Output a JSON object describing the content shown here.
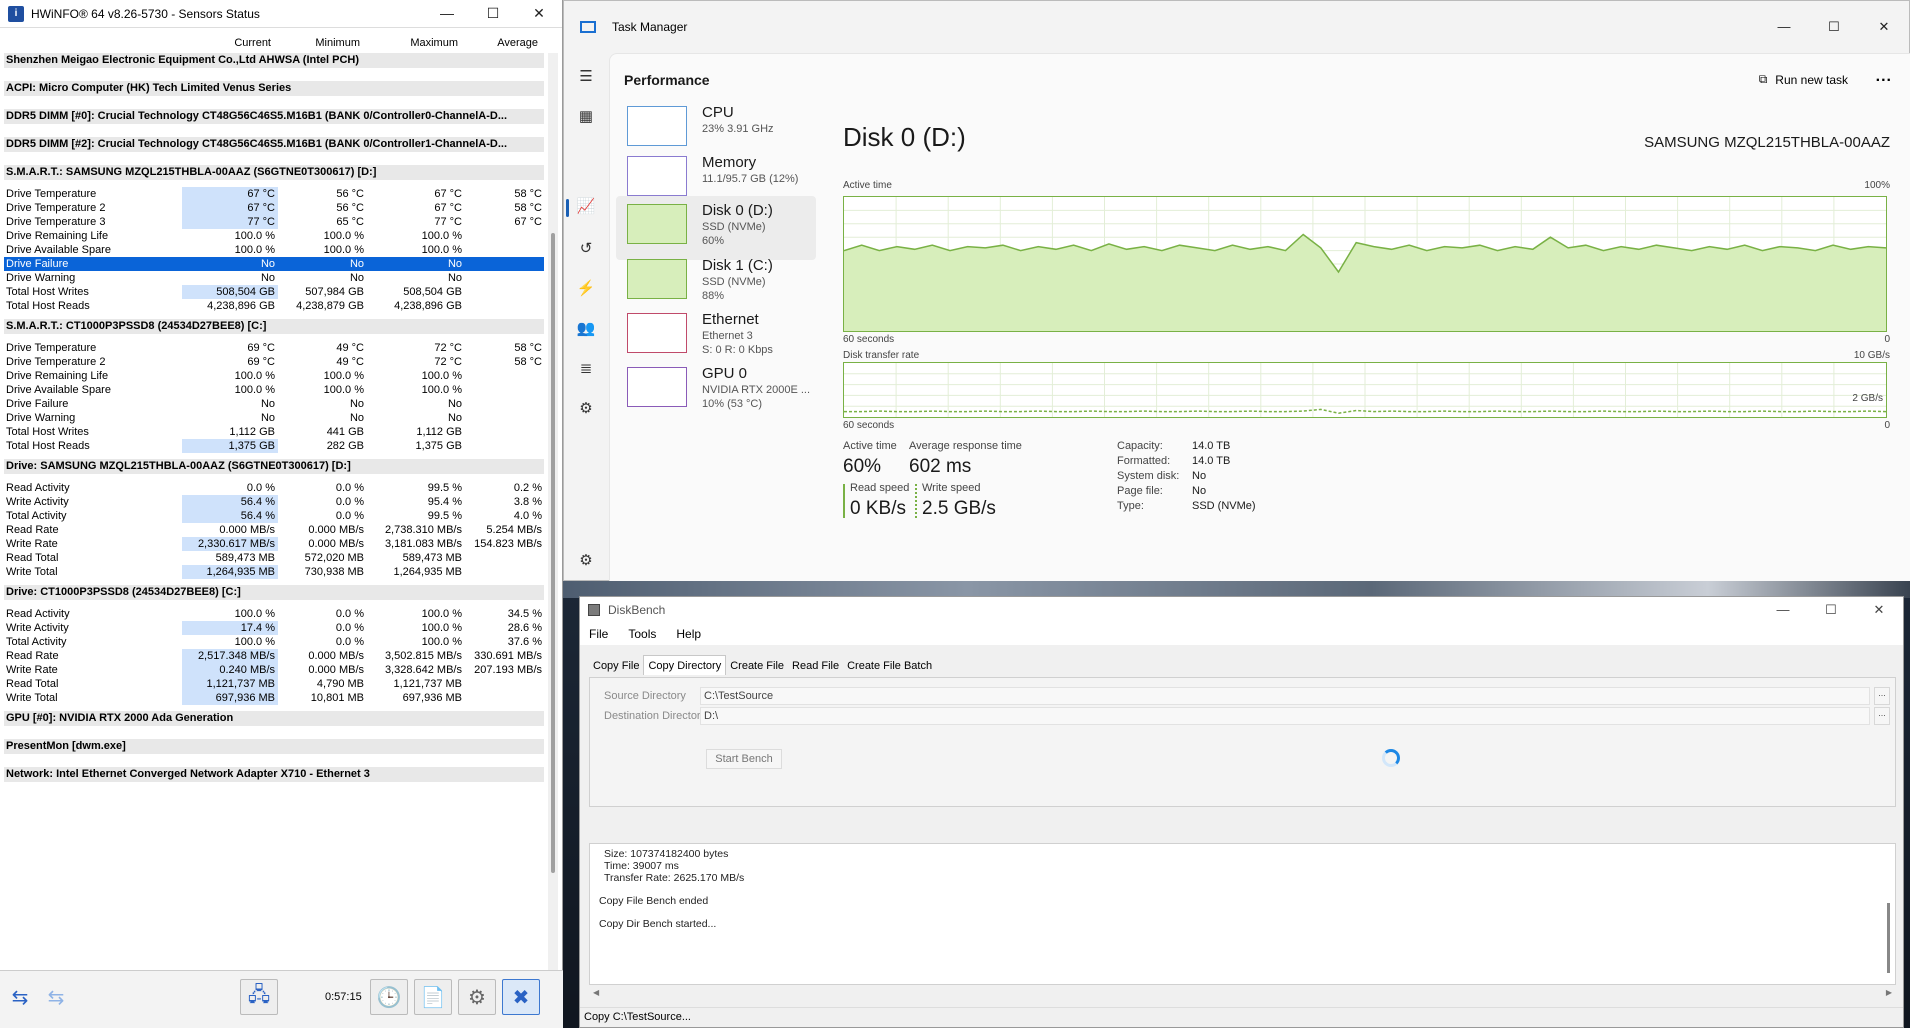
{
  "hwinfo": {
    "title": "HWiNFO® 64 v8.26-5730 - Sensors Status",
    "columns": [
      "Current",
      "Minimum",
      "Maximum",
      "Average"
    ],
    "toolbar_time": "0:57:15",
    "sections": [
      {
        "type": "header",
        "text": "Shenzhen Meigao Electronic Equipment Co.,Ltd AHWSA (Intel PCH)"
      },
      {
        "type": "header",
        "text": "ACPI: Micro Computer (HK) Tech Limited Venus Series"
      },
      {
        "type": "header",
        "text": "DDR5 DIMM [#0]: Crucial Technology CT48G56C46S5.M16B1 (BANK 0/Controller0-ChannelA-D..."
      },
      {
        "type": "header",
        "text": "DDR5 DIMM [#2]: Crucial Technology CT48G56C46S5.M16B1 (BANK 0/Controller1-ChannelA-D..."
      },
      {
        "type": "header",
        "text": "S.M.A.R.T.: SAMSUNG MZQL215THBLA-00AAZ (S6GTNE0T300617) [D:]"
      },
      {
        "type": "row",
        "label": "Drive Temperature",
        "cur": "67 °C",
        "min": "56 °C",
        "max": "67 °C",
        "avg": "58 °C",
        "hl": true
      },
      {
        "type": "row",
        "label": "Drive Temperature 2",
        "cur": "67 °C",
        "min": "56 °C",
        "max": "67 °C",
        "avg": "58 °C",
        "hl": true
      },
      {
        "type": "row",
        "label": "Drive Temperature 3",
        "cur": "77 °C",
        "min": "65 °C",
        "max": "77 °C",
        "avg": "67 °C",
        "hl": true
      },
      {
        "type": "row",
        "label": "Drive Remaining Life",
        "cur": "100.0 %",
        "min": "100.0 %",
        "max": "100.0 %",
        "avg": ""
      },
      {
        "type": "row",
        "label": "Drive Available Spare",
        "cur": "100.0 %",
        "min": "100.0 %",
        "max": "100.0 %",
        "avg": ""
      },
      {
        "type": "row",
        "label": "Drive Failure",
        "cur": "No",
        "min": "No",
        "max": "No",
        "avg": "",
        "sel": true
      },
      {
        "type": "row",
        "label": "Drive Warning",
        "cur": "No",
        "min": "No",
        "max": "No",
        "avg": ""
      },
      {
        "type": "row",
        "label": "Total Host Writes",
        "cur": "508,504 GB",
        "min": "507,984 GB",
        "max": "508,504 GB",
        "avg": "",
        "hl": true
      },
      {
        "type": "row",
        "label": "Total Host Reads",
        "cur": "4,238,896 GB",
        "min": "4,238,879 GB",
        "max": "4,238,896 GB",
        "avg": ""
      },
      {
        "type": "header",
        "text": "S.M.A.R.T.: CT1000P3PSSD8 (24534D27BEE8) [C:]"
      },
      {
        "type": "row",
        "label": "Drive Temperature",
        "cur": "69 °C",
        "min": "49 °C",
        "max": "72 °C",
        "avg": "58 °C"
      },
      {
        "type": "row",
        "label": "Drive Temperature 2",
        "cur": "69 °C",
        "min": "49 °C",
        "max": "72 °C",
        "avg": "58 °C"
      },
      {
        "type": "row",
        "label": "Drive Remaining Life",
        "cur": "100.0 %",
        "min": "100.0 %",
        "max": "100.0 %",
        "avg": ""
      },
      {
        "type": "row",
        "label": "Drive Available Spare",
        "cur": "100.0 %",
        "min": "100.0 %",
        "max": "100.0 %",
        "avg": ""
      },
      {
        "type": "row",
        "label": "Drive Failure",
        "cur": "No",
        "min": "No",
        "max": "No",
        "avg": ""
      },
      {
        "type": "row",
        "label": "Drive Warning",
        "cur": "No",
        "min": "No",
        "max": "No",
        "avg": ""
      },
      {
        "type": "row",
        "label": "Total Host Writes",
        "cur": "1,112 GB",
        "min": "441 GB",
        "max": "1,112 GB",
        "avg": ""
      },
      {
        "type": "row",
        "label": "Total Host Reads",
        "cur": "1,375 GB",
        "min": "282 GB",
        "max": "1,375 GB",
        "avg": "",
        "hl": true
      },
      {
        "type": "header",
        "text": "Drive: SAMSUNG MZQL215THBLA-00AAZ (S6GTNE0T300617) [D:]"
      },
      {
        "type": "row",
        "label": "Read Activity",
        "cur": "0.0 %",
        "min": "0.0 %",
        "max": "99.5 %",
        "avg": "0.2 %"
      },
      {
        "type": "row",
        "label": "Write Activity",
        "cur": "56.4 %",
        "min": "0.0 %",
        "max": "95.4 %",
        "avg": "3.8 %",
        "hl": true
      },
      {
        "type": "row",
        "label": "Total Activity",
        "cur": "56.4 %",
        "min": "0.0 %",
        "max": "99.5 %",
        "avg": "4.0 %",
        "hl": true
      },
      {
        "type": "row",
        "label": "Read Rate",
        "cur": "0.000 MB/s",
        "min": "0.000 MB/s",
        "max": "2,738.310 MB/s",
        "avg": "5.254 MB/s"
      },
      {
        "type": "row",
        "label": "Write Rate",
        "cur": "2,330.617 MB/s",
        "min": "0.000 MB/s",
        "max": "3,181.083 MB/s",
        "avg": "154.823 MB/s",
        "hl": true
      },
      {
        "type": "row",
        "label": "Read Total",
        "cur": "589,473 MB",
        "min": "572,020 MB",
        "max": "589,473 MB",
        "avg": ""
      },
      {
        "type": "row",
        "label": "Write Total",
        "cur": "1,264,935 MB",
        "min": "730,938 MB",
        "max": "1,264,935 MB",
        "avg": "",
        "hl": true
      },
      {
        "type": "header",
        "text": "Drive: CT1000P3PSSD8 (24534D27BEE8) [C:]"
      },
      {
        "type": "row",
        "label": "Read Activity",
        "cur": "100.0 %",
        "min": "0.0 %",
        "max": "100.0 %",
        "avg": "34.5 %"
      },
      {
        "type": "row",
        "label": "Write Activity",
        "cur": "17.4 %",
        "min": "0.0 %",
        "max": "100.0 %",
        "avg": "28.6 %",
        "hl": true
      },
      {
        "type": "row",
        "label": "Total Activity",
        "cur": "100.0 %",
        "min": "0.0 %",
        "max": "100.0 %",
        "avg": "37.6 %"
      },
      {
        "type": "row",
        "label": "Read Rate",
        "cur": "2,517.348 MB/s",
        "min": "0.000 MB/s",
        "max": "3,502.815 MB/s",
        "avg": "330.691 MB/s",
        "hl": true
      },
      {
        "type": "row",
        "label": "Write Rate",
        "cur": "0.240 MB/s",
        "min": "0.000 MB/s",
        "max": "3,328.642 MB/s",
        "avg": "207.193 MB/s",
        "hl": true
      },
      {
        "type": "row",
        "label": "Read Total",
        "cur": "1,121,737 MB",
        "min": "4,790 MB",
        "max": "1,121,737 MB",
        "avg": "",
        "hl": true
      },
      {
        "type": "row",
        "label": "Write Total",
        "cur": "697,936 MB",
        "min": "10,801 MB",
        "max": "697,936 MB",
        "avg": "",
        "hl": true
      },
      {
        "type": "header",
        "text": "GPU [#0]: NVIDIA RTX 2000 Ada Generation"
      },
      {
        "type": "header",
        "text": "PresentMon [dwm.exe]"
      },
      {
        "type": "header",
        "text": "Network: Intel Ethernet Converged Network Adapter X710 - Ethernet 3"
      }
    ]
  },
  "taskmanager": {
    "title": "Task Manager",
    "section_title": "Performance",
    "run_new_task": "Run new task",
    "more": "...",
    "items": [
      {
        "name": "CPU",
        "sub": "23% 3.91 GHz",
        "active": false
      },
      {
        "name": "Memory",
        "sub": "11.1/95.7 GB (12%)",
        "active": false
      },
      {
        "name": "Disk 0 (D:)",
        "sub": "SSD (NVMe)\n60%",
        "active": true
      },
      {
        "name": "Disk 1 (C:)",
        "sub": "SSD (NVMe)\n88%",
        "active": false
      },
      {
        "name": "Ethernet",
        "sub": "Ethernet 3\nS: 0 R: 0 Kbps",
        "active": false
      },
      {
        "name": "GPU 0",
        "sub": "NVIDIA RTX 2000E ...\n10% (53 °C)",
        "active": false
      }
    ],
    "disk_title": "Disk 0 (D:)",
    "disk_model": "SAMSUNG MZQL215THBLA-00AAZ",
    "active_time_label": "Active time",
    "active_time_max": "100%",
    "seconds_label": "60 seconds",
    "zero": "0",
    "transfer_label": "Disk transfer rate",
    "transfer_max": "10 GB/s",
    "transfer_mid": "2 GB/s",
    "stats": {
      "active_time_label": "Active time",
      "active_time": "60%",
      "avg_resp_label": "Average response time",
      "avg_resp": "602 ms",
      "read_label": "Read speed",
      "read": "0 KB/s",
      "write_label": "Write speed",
      "write": "2.5 GB/s"
    },
    "specs": [
      {
        "label": "Capacity:",
        "value": "14.0 TB"
      },
      {
        "label": "Formatted:",
        "value": "14.0 TB"
      },
      {
        "label": "System disk:",
        "value": "No"
      },
      {
        "label": "Page file:",
        "value": "No"
      },
      {
        "label": "Type:",
        "value": "SSD (NVMe)"
      }
    ],
    "colors": {
      "accent": "#1a5fb4",
      "disk_fill": "#d7eebb",
      "disk_line": "#79b145"
    },
    "active_series": [
      60,
      64,
      60,
      63,
      61,
      64,
      60,
      63,
      62,
      64,
      60,
      63,
      61,
      64,
      60,
      65,
      61,
      63,
      60,
      64,
      62,
      60,
      64,
      61,
      63,
      60,
      72,
      62,
      44,
      66,
      63,
      61,
      64,
      60,
      63,
      62,
      64,
      60,
      63,
      61,
      70,
      62,
      64,
      60,
      63,
      61,
      64,
      62,
      60,
      63,
      61,
      64,
      60,
      63,
      62,
      60,
      64,
      61,
      63,
      62
    ],
    "transfer_series": [
      10,
      10,
      11,
      10,
      10,
      11,
      10,
      10,
      11,
      10,
      10,
      11,
      10,
      10,
      11,
      10,
      10,
      11,
      10,
      10,
      11,
      10,
      10,
      11,
      10,
      10,
      11,
      14,
      7,
      12,
      10,
      11,
      10,
      10,
      11,
      10,
      10,
      11,
      10,
      10,
      11,
      10,
      10,
      11,
      10,
      10,
      11,
      10,
      10,
      11,
      10,
      10,
      11,
      10,
      10,
      11,
      10,
      10,
      11,
      10
    ]
  },
  "diskbench": {
    "title": "DiskBench",
    "menu": [
      "File",
      "Tools",
      "Help"
    ],
    "tabs": [
      "Copy File",
      "Copy Directory",
      "Create File",
      "Read File",
      "Create File Batch"
    ],
    "active_tab": 1,
    "source_label": "Source Directory",
    "source_value": "C:\\TestSource",
    "dest_label": "Destination Directory",
    "dest_value": "D:\\",
    "dots": "...",
    "start_label": "Start Bench",
    "log": [
      "Size: 107374182400 bytes",
      "Time: 39007 ms",
      "Transfer Rate: 2625.170 MB/s",
      "Copy File Bench ended",
      "Copy Dir Bench started..."
    ],
    "status": "Copy C:\\TestSource..."
  }
}
